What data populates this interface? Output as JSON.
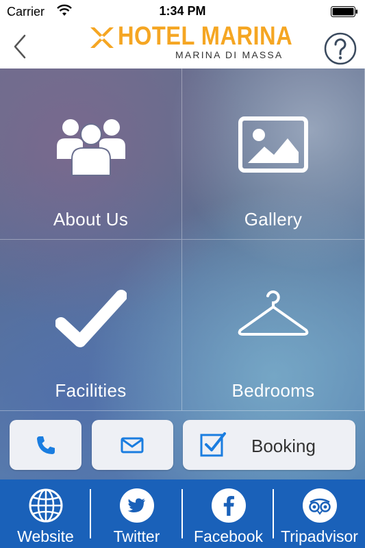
{
  "status_bar": {
    "carrier": "Carrier",
    "time": "1:34 PM"
  },
  "header": {
    "logo_title": "HOTEL MARINA",
    "logo_subtitle": "MARINA DI MASSA",
    "accent_color": "#f5a623"
  },
  "tiles": [
    {
      "label": "About Us",
      "icon": "people-icon"
    },
    {
      "label": "Gallery",
      "icon": "image-icon"
    },
    {
      "label": "Facilities",
      "icon": "checkmark-icon"
    },
    {
      "label": "Bedrooms",
      "icon": "hanger-icon"
    }
  ],
  "actions": {
    "phone_icon": "phone-icon",
    "email_icon": "envelope-icon",
    "booking_label": "Booking",
    "booking_icon": "checkbox-icon",
    "icon_color": "#1a7de0"
  },
  "social": {
    "bar_color": "#1a61b9",
    "items": [
      {
        "label": "Website",
        "icon": "globe-icon"
      },
      {
        "label": "Twitter",
        "icon": "twitter-icon"
      },
      {
        "label": "Facebook",
        "icon": "facebook-icon"
      },
      {
        "label": "Tripadvisor",
        "icon": "tripadvisor-icon"
      }
    ]
  }
}
